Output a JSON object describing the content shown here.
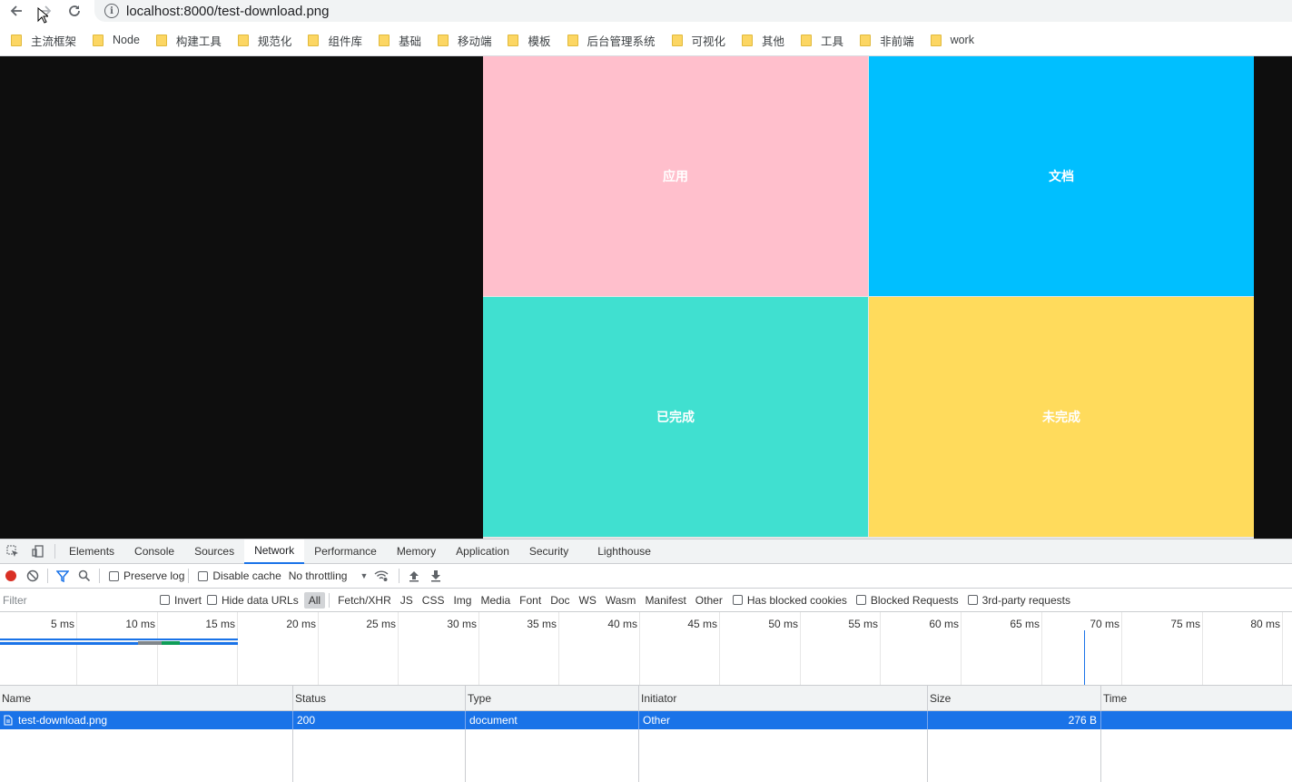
{
  "browser": {
    "url": "localhost:8000/test-download.png",
    "bookmarks": [
      "主流框架",
      "Node",
      "构建工具",
      "规范化",
      "组件库",
      "基础",
      "移动端",
      "模板",
      "后台管理系统",
      "可视化",
      "其他",
      "工具",
      "非前端",
      "work"
    ]
  },
  "page": {
    "cells": [
      {
        "label": "应用",
        "color": "#ffbfcc"
      },
      {
        "label": "文档",
        "color": "#00bfff"
      },
      {
        "label": "已完成",
        "color": "#40e0d0"
      },
      {
        "label": "未完成",
        "color": "#ffdb5c"
      }
    ],
    "background": "#0e0e0e"
  },
  "devtools": {
    "tabs": [
      "Elements",
      "Console",
      "Sources",
      "Network",
      "Performance",
      "Memory",
      "Application",
      "Security",
      "Lighthouse"
    ],
    "active_tab": "Network",
    "controls": {
      "preserve_log": "Preserve log",
      "disable_cache": "Disable cache",
      "throttling": "No throttling"
    },
    "filter": {
      "placeholder": "Filter",
      "invert": "Invert",
      "hide_data_urls": "Hide data URLs",
      "types": [
        "All",
        "Fetch/XHR",
        "JS",
        "CSS",
        "Img",
        "Media",
        "Font",
        "Doc",
        "WS",
        "Wasm",
        "Manifest",
        "Other"
      ],
      "has_blocked_cookies": "Has blocked cookies",
      "blocked_requests": "Blocked Requests",
      "third_party": "3rd-party requests"
    },
    "timeline_ticks": [
      "5 ms",
      "10 ms",
      "15 ms",
      "20 ms",
      "25 ms",
      "30 ms",
      "35 ms",
      "40 ms",
      "45 ms",
      "50 ms",
      "55 ms",
      "60 ms",
      "65 ms",
      "70 ms",
      "75 ms",
      "80 ms"
    ],
    "columns": [
      "Name",
      "Status",
      "Type",
      "Initiator",
      "Size",
      "Time"
    ],
    "requests": [
      {
        "name": "test-download.png",
        "status": "200",
        "type": "document",
        "initiator": "Other",
        "size": "276 B",
        "time": ""
      }
    ]
  }
}
